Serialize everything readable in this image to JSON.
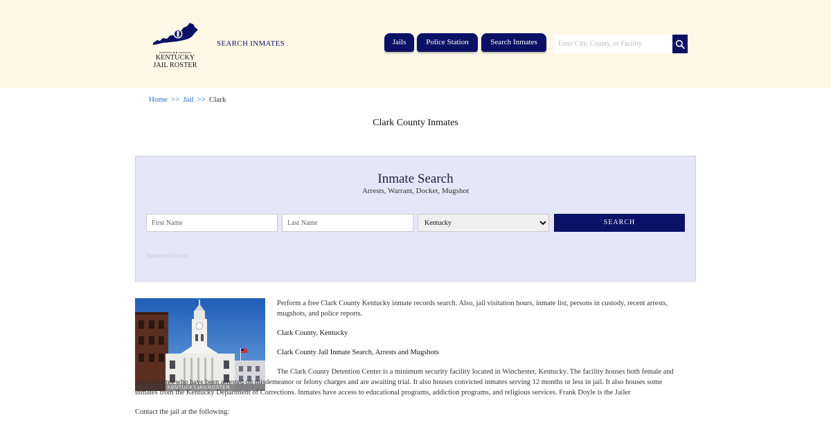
{
  "brand": {
    "logo_line1": "KENTUCKY",
    "logo_line2": "JAIL ROSTER",
    "accent_color": "#0b1266",
    "header_bg": "#fef8e7"
  },
  "header": {
    "search_inmates_link": "SEARCH INMATES",
    "nav": {
      "jails": "Jails",
      "police_station": "Police Station",
      "search_inmates": "Search Inmates"
    },
    "search_placeholder": "Enter City, County, or Facility",
    "search_icon": "magnifier-icon"
  },
  "breadcrumb": {
    "home": "Home",
    "sep": ">>",
    "jail": "Jail",
    "current": "Clark"
  },
  "page_title": "Clark County Inmates",
  "inmate_search": {
    "title": "Inmate Search",
    "subtitle": "Arrests, Warrant, Docket, Mugshot",
    "first_name_placeholder": "First Name",
    "last_name_placeholder": "Last Name",
    "state_selected": "Kentucky",
    "submit_label": "SEARCH",
    "sponsored": "Sponsored Results",
    "bg_color": "#e5e6f7"
  },
  "content": {
    "intro": "Perform a free Clark County Kentucky inmate records search. Also, jail visitation hours, inmate list, persons in custody, recent arrests, mugshots, and police reports.",
    "heading1": "Clark County, Kentucky",
    "heading2": "Clark County Jail Inmate Search, Arrests and Mugshots",
    "paragraph": "The Clark County Detention Center is a minimum security facility located in Winchester, Kentucky. The facility houses both female and male inmates who have been arrested on misdemeanor or felony charges and are awaiting trial. It also houses convicted inmates serving 12 months or less in jail. It also houses some inmates from the Kentucky Department of Corrections. Inmates have access to educational programs, addiction programs, and religious services. Frank Doyle is the Jailer",
    "contact": "Contact the jail at the following:",
    "photo_caption": "KENTUCKYJAILROSTER"
  }
}
